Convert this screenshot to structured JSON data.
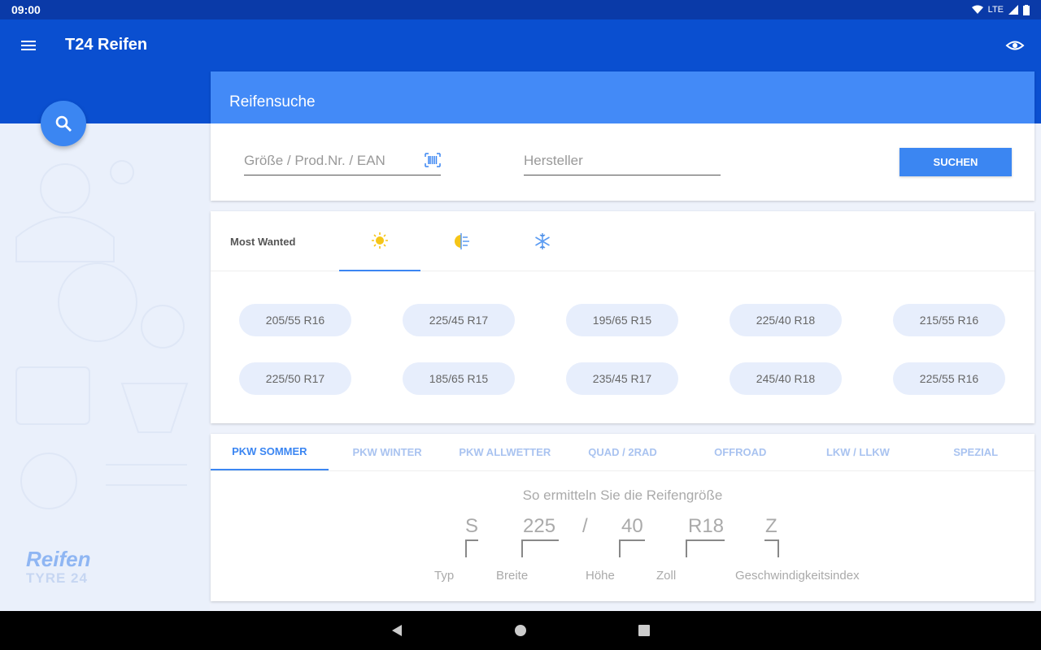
{
  "status": {
    "time": "09:00",
    "network": "LTE"
  },
  "app": {
    "title": "T24 Reifen"
  },
  "search": {
    "header": "Reifensuche",
    "size_placeholder": "Größe / Prod.Nr. / EAN",
    "maker_placeholder": "Hersteller",
    "button": "SUCHEN"
  },
  "most_wanted": {
    "label": "Most Wanted",
    "seasons": [
      "summer-icon",
      "allseason-icon",
      "winter-icon"
    ],
    "sizes": [
      "205/55 R16",
      "225/45 R17",
      "195/65 R15",
      "225/40 R18",
      "215/55 R16",
      "225/50 R17",
      "185/65 R15",
      "235/45 R17",
      "245/40 R18",
      "225/55 R16"
    ]
  },
  "categories": [
    "PKW SOMMER",
    "PKW WINTER",
    "PKW ALLWETTER",
    "QUAD / 2RAD",
    "OFFROAD",
    "LKW / LLKW",
    "SPEZIAL"
  ],
  "guide": {
    "title": "So ermitteln Sie die Reifengröße",
    "values": {
      "type": "S",
      "width": "225",
      "slash": "/",
      "height": "40",
      "rim": "R18",
      "speed": "Z"
    },
    "labels": {
      "type": "Typ",
      "width": "Breite",
      "height": "Höhe",
      "rim": "Zoll",
      "speed": "Geschwindigkeitsindex"
    }
  },
  "brand": {
    "main": "Reifen",
    "sub": "TYRE 24"
  },
  "colors": {
    "appbar": "#0a4fd0",
    "accent": "#3b86f2",
    "header": "#438af7"
  }
}
